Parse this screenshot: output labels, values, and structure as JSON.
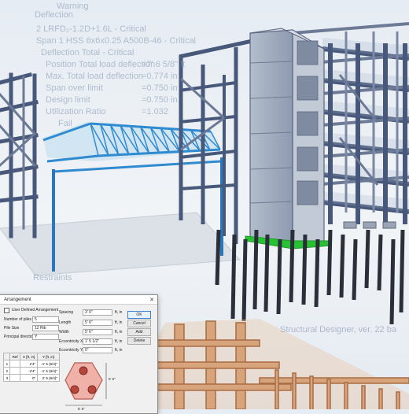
{
  "overlay": {
    "lines": [
      "Warning",
      "Deflection",
      "2 LRFD₂-1.2D+1.6L - Critical",
      "Span 1 HSS 6x6x0.25 A500B-46 - Critical",
      "Deflection Total - Critical",
      "Position Total load deflection",
      "Max. Total load deflection",
      "Span over limit",
      "Design limit",
      "Utilization Ratio",
      "Fail"
    ],
    "values": [
      "=7' 6 5/8\" ft",
      "=0.774 in",
      "=0.750 in",
      "=0.750 in",
      "=1.032"
    ],
    "restraints": "Restraints",
    "watermark": "Structural Designer, ver. 22 ba"
  },
  "dialog": {
    "title": "Arrangement",
    "close": "✕",
    "user_defined": "User Defined Arrangement",
    "left_fields": [
      {
        "label": "Number of piles",
        "value": "5"
      },
      {
        "label": "Pile Size",
        "value": "12 Rib"
      },
      {
        "label": "Principal direction",
        "value": "Y"
      }
    ],
    "right_fields": [
      {
        "label": "Spacing",
        "value": "3' 0\"",
        "unit": "ft, in"
      },
      {
        "label": "Length",
        "value": "5' 6\"",
        "unit": "ft, in"
      },
      {
        "label": "Width",
        "value": "5' 6\"",
        "unit": "ft, in"
      },
      {
        "label": "Eccentricity X",
        "value": "1' 5 1/2\"",
        "unit": "ft, in"
      },
      {
        "label": "Eccentricity Y",
        "value": "0\"",
        "unit": "ft, in"
      }
    ],
    "buttons": [
      "OK",
      "Cancel",
      "Add",
      "Delete"
    ],
    "table": {
      "headers": [
        "",
        "Ref",
        "X [ft, in]",
        "Y [ft, in]"
      ],
      "rows": [
        [
          "1",
          "",
          "2'4\"",
          "-1' 5 (6/4)\""
        ],
        [
          "2",
          "",
          "-2'4\"",
          "-1' 5 (6/4)\""
        ],
        [
          "3",
          "",
          "0\"",
          "2' 5 (6/4)\""
        ]
      ]
    },
    "dim_label_1": "5' 6\"",
    "dim_label_2": "5' 6\""
  },
  "colors": {
    "steel": "#48587a",
    "steel_light": "#8593ad",
    "blue": "#2f8ad0",
    "green": "#27c233",
    "core": "#a8b2c3",
    "piles": "#2a2f3a",
    "timber": "#c88e62",
    "slab": "#c9d0d8"
  }
}
